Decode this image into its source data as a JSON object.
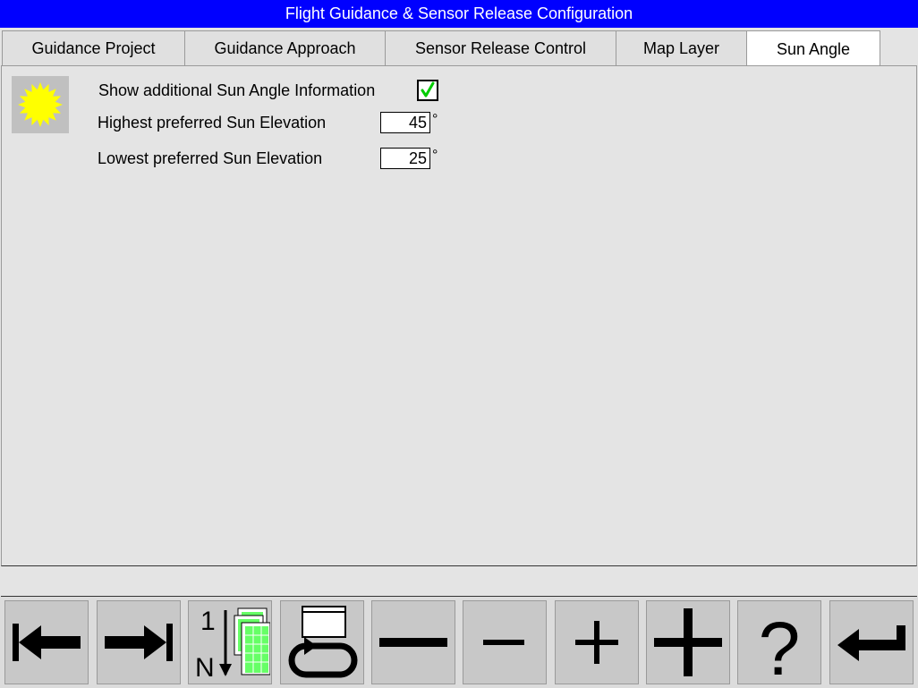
{
  "window": {
    "title": "Flight Guidance & Sensor Release Configuration"
  },
  "tabs": [
    {
      "label": "Guidance Project",
      "active": false
    },
    {
      "label": "Guidance Approach",
      "active": false
    },
    {
      "label": "Sensor Release Control",
      "active": false
    },
    {
      "label": "Map Layer",
      "active": false
    },
    {
      "label": "Sun Angle",
      "active": true
    }
  ],
  "sun_angle": {
    "icon": "sun-icon",
    "show_info_label": "Show additional Sun Angle Information",
    "show_info_checked": true,
    "highest_label": "Highest preferred Sun Elevation",
    "highest_value": "45",
    "lowest_label": "Lowest preferred Sun Elevation",
    "lowest_value": "25",
    "degree_symbol": "°"
  },
  "status": {
    "text": ""
  },
  "toolbar": {
    "buttons": [
      {
        "icon": "arrow-left-to-bar-icon"
      },
      {
        "icon": "arrow-right-to-bar-icon"
      },
      {
        "icon": "sort-1-to-n-icon",
        "top_label": "1",
        "bottom_label": "N"
      },
      {
        "icon": "cycle-window-icon"
      },
      {
        "icon": "big-minus-icon"
      },
      {
        "icon": "small-minus-icon"
      },
      {
        "icon": "small-plus-icon"
      },
      {
        "icon": "big-plus-icon"
      },
      {
        "icon": "help-icon",
        "label": "?"
      },
      {
        "icon": "enter-return-icon"
      }
    ]
  },
  "colors": {
    "titlebar_bg": "#0000ff",
    "sun_fill": "#ffff00",
    "check_color": "#00cc00",
    "grid_green": "#66ff66"
  }
}
